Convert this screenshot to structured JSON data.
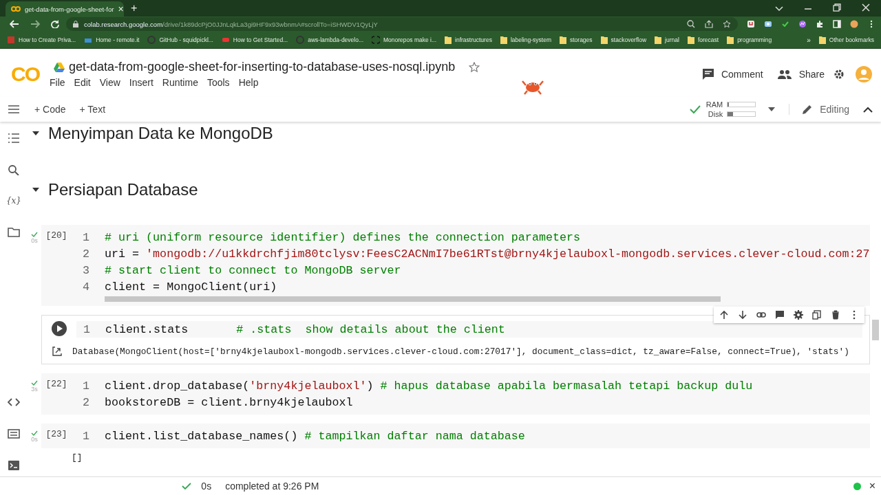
{
  "browser": {
    "tab": {
      "title": "get-data-from-google-sheet-for",
      "close": "×"
    },
    "new_tab": "+",
    "url": {
      "host": "colab.research.google.com",
      "path": "/drive/1k89dcPjO0JJnLqkLa3gi9HF9x93wbnmA#scrollTo=iSHWDV1QyLjY"
    },
    "bookmarks": [
      {
        "kind": "site",
        "label": "How to Create Priva..."
      },
      {
        "kind": "site",
        "label": "Home - remote.it"
      },
      {
        "kind": "site",
        "label": "GitHub - squidpickl..."
      },
      {
        "kind": "site",
        "label": "How to Get Started..."
      },
      {
        "kind": "site",
        "label": "aws-lambda-develo..."
      },
      {
        "kind": "site",
        "label": "Monorepos make i..."
      },
      {
        "kind": "folder",
        "label": "infrastructures"
      },
      {
        "kind": "folder",
        "label": "labeling-system"
      },
      {
        "kind": "folder",
        "label": "storages"
      },
      {
        "kind": "folder",
        "label": "stackoverflow"
      },
      {
        "kind": "folder",
        "label": "jurnal"
      },
      {
        "kind": "folder",
        "label": "forecast"
      },
      {
        "kind": "folder",
        "label": "programming"
      }
    ],
    "overflow": "»",
    "other_bookmarks": "Other bookmarks"
  },
  "notebook": {
    "logo": "CO",
    "title": "get-data-from-google-sheet-for-inserting-to-database-uses-nosql.ipynb",
    "menu": [
      "File",
      "Edit",
      "View",
      "Insert",
      "Runtime",
      "Tools",
      "Help"
    ],
    "comment": "Comment",
    "share": "Share"
  },
  "toolbar": {
    "add_code": "+ Code",
    "add_text": "+ Text",
    "ram": {
      "label": "RAM",
      "level": 0.05
    },
    "disk": {
      "label": "Disk",
      "level": 0.2
    },
    "mode": "Editing"
  },
  "sidebar": {
    "variables": "{x}"
  },
  "sections": [
    {
      "kind": "heading",
      "title": "Menyimpan Data ke MongoDB",
      "expanded": true
    },
    {
      "kind": "heading",
      "title": "Persiapan Database",
      "expanded": true
    },
    {
      "kind": "code",
      "count": "[20]",
      "time": "0s",
      "selected": false,
      "scrollbar": true,
      "lines": [
        {
          "number": "1",
          "tokens": [
            {
              "kind": "comment",
              "text": "# uri (uniform resource identifier) defines the connection parameters"
            }
          ]
        },
        {
          "number": "2",
          "tokens": [
            {
              "kind": "plain",
              "text": "uri = "
            },
            {
              "kind": "string",
              "text": "'mongodb://u1kkdrchfjim80tclysv:FeesC2ACNmI7be61RTst@brny4kjelauboxl-mongodb.services.clever-cloud.com:27"
            }
          ]
        },
        {
          "number": "3",
          "tokens": [
            {
              "kind": "comment",
              "text": "# start client to connect to MongoDB server"
            }
          ]
        },
        {
          "number": "4",
          "tokens": [
            {
              "kind": "plain",
              "text": "client = MongoClient(uri)"
            }
          ]
        }
      ]
    },
    {
      "kind": "code",
      "selected": true,
      "lines": [
        {
          "number": "1",
          "tokens": [
            {
              "kind": "plain",
              "text": "client.stats       "
            },
            {
              "kind": "comment",
              "text": "# .stats  show details about the client"
            }
          ]
        }
      ],
      "output": "Database(MongoClient(host=['brny4kjelauboxl-mongodb.services.clever-cloud.com:27017'], document_class=dict, tz_aware=False, connect=True), 'stats')"
    },
    {
      "kind": "code",
      "count": "[22]",
      "time": "3s",
      "selected": false,
      "lines": [
        {
          "number": "1",
          "tokens": [
            {
              "kind": "plain",
              "text": "client.drop_database("
            },
            {
              "kind": "string",
              "text": "'brny4kjelauboxl'"
            },
            {
              "kind": "plain",
              "text": ") "
            },
            {
              "kind": "comment",
              "text": "# hapus database apabila bermasalah tetapi backup dulu"
            }
          ]
        },
        {
          "number": "2",
          "tokens": [
            {
              "kind": "plain",
              "text": "bookstoreDB = client.brny4kjelauboxl"
            }
          ]
        }
      ]
    },
    {
      "kind": "code",
      "count": "[23]",
      "time": "0s",
      "selected": false,
      "lines": [
        {
          "number": "1",
          "tokens": [
            {
              "kind": "plain",
              "text": "client.list_database_names() "
            },
            {
              "kind": "comment",
              "text": "# tampilkan daftar nama database"
            }
          ]
        }
      ],
      "output": "[]"
    }
  ],
  "status_bar": {
    "time": "0s",
    "message": "completed at 9:26 PM",
    "connected": true,
    "close": "×"
  }
}
